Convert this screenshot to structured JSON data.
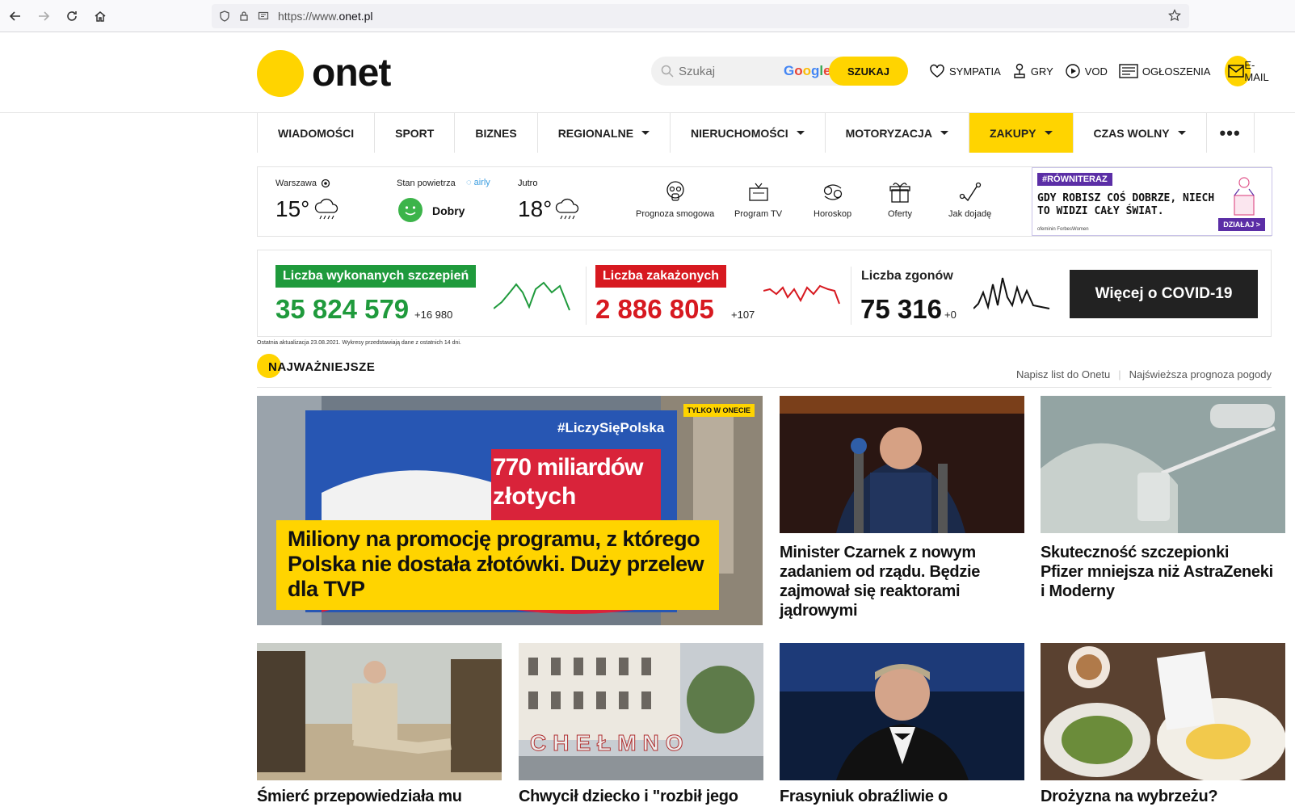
{
  "browser": {
    "url_prefix": "https://www.",
    "url_domain": "onet.pl"
  },
  "header": {
    "logo_text": "onet",
    "search_placeholder": "Szukaj",
    "google_label": "Google",
    "search_button": "SZUKAJ",
    "links": [
      "SYMPATIA",
      "GRY",
      "VOD",
      "OGŁOSZENIA"
    ],
    "email_label": "E-MAIL"
  },
  "nav": {
    "items": [
      {
        "label": "WIADOMOŚCI",
        "caret": false,
        "active": false
      },
      {
        "label": "SPORT",
        "caret": false,
        "active": false
      },
      {
        "label": "BIZNES",
        "caret": false,
        "active": false
      },
      {
        "label": "REGIONALNE",
        "caret": true,
        "active": false
      },
      {
        "label": "NIERUCHOMOŚCI",
        "caret": true,
        "active": false
      },
      {
        "label": "MOTORYZACJA",
        "caret": true,
        "active": false
      },
      {
        "label": "ZAKUPY",
        "caret": true,
        "active": true
      },
      {
        "label": "CZAS WOLNY",
        "caret": true,
        "active": false
      }
    ],
    "more": "•••"
  },
  "weather": {
    "city": "Warszawa",
    "temp": "15°",
    "air_label": "Stan powietrza",
    "airly": "airly",
    "air_value": "Dobry",
    "tomorrow_label": "Jutro",
    "tomorrow_temp": "18°",
    "services": [
      "Prognoza smogowa",
      "Program TV",
      "Horoskop",
      "Oferty",
      "Jak dojadę"
    ],
    "ad": {
      "tag": "#RÓWNITERAZ",
      "text": "GDY ROBISZ COŚ DOBRZE, NIECH TO WIDZI CAŁY ŚWIAT.",
      "button": "DZIAŁAJ >",
      "logos": "ofeminin   ForbesWomen"
    }
  },
  "covid": {
    "vaccinations": {
      "label": "Liczba wykonanych szczepień",
      "value": "35 824 579",
      "delta": "+16 980",
      "color": "#1f9a3c"
    },
    "infections": {
      "label": "Liczba zakażonych",
      "value": "2 886 805",
      "delta": "+107",
      "color": "#d71920"
    },
    "deaths": {
      "label": "Liczba zgonów",
      "value": "75 316",
      "delta": "+0",
      "color": "#111111"
    },
    "button": "Więcej o COVID-19",
    "note": "Ostatnia aktualizacja 23.08.2021. Wykresy przedstawiają dane z ostatnich 14 dni."
  },
  "section": {
    "title": "NAJWAŻNIEJSZE",
    "links": [
      "Napisz list do Onetu",
      "Najświeższa prognoza pogody"
    ]
  },
  "articles": {
    "hero": {
      "badge": "TYLKO W ONECIE",
      "title": "Miliony na promocję programu, z którego Polska nie dostała złotówki. Duży przelew dla TVP",
      "billboard_hashtag": "#LiczySięPolska",
      "billboard_line1": "770 miliardów",
      "billboard_line2": "złotych"
    },
    "top": [
      {
        "title": "Minister Czarnek z nowym zadaniem od rządu. Będzie zajmował się reaktorami jądrowymi"
      },
      {
        "title": "Skuteczność szczepionki Pfizer mniejsza niż AstraZeneki i Moderny"
      }
    ],
    "bottom": [
      {
        "title": "Śmierć przepowiedziała mu"
      },
      {
        "title": "Chwycił dziecko i \"rozbił jego"
      },
      {
        "title": "Frasyniuk obraźliwie o"
      },
      {
        "title": "Drożyzna na wybrzeżu?"
      }
    ],
    "chelmno_text": "CHEŁMNO"
  }
}
